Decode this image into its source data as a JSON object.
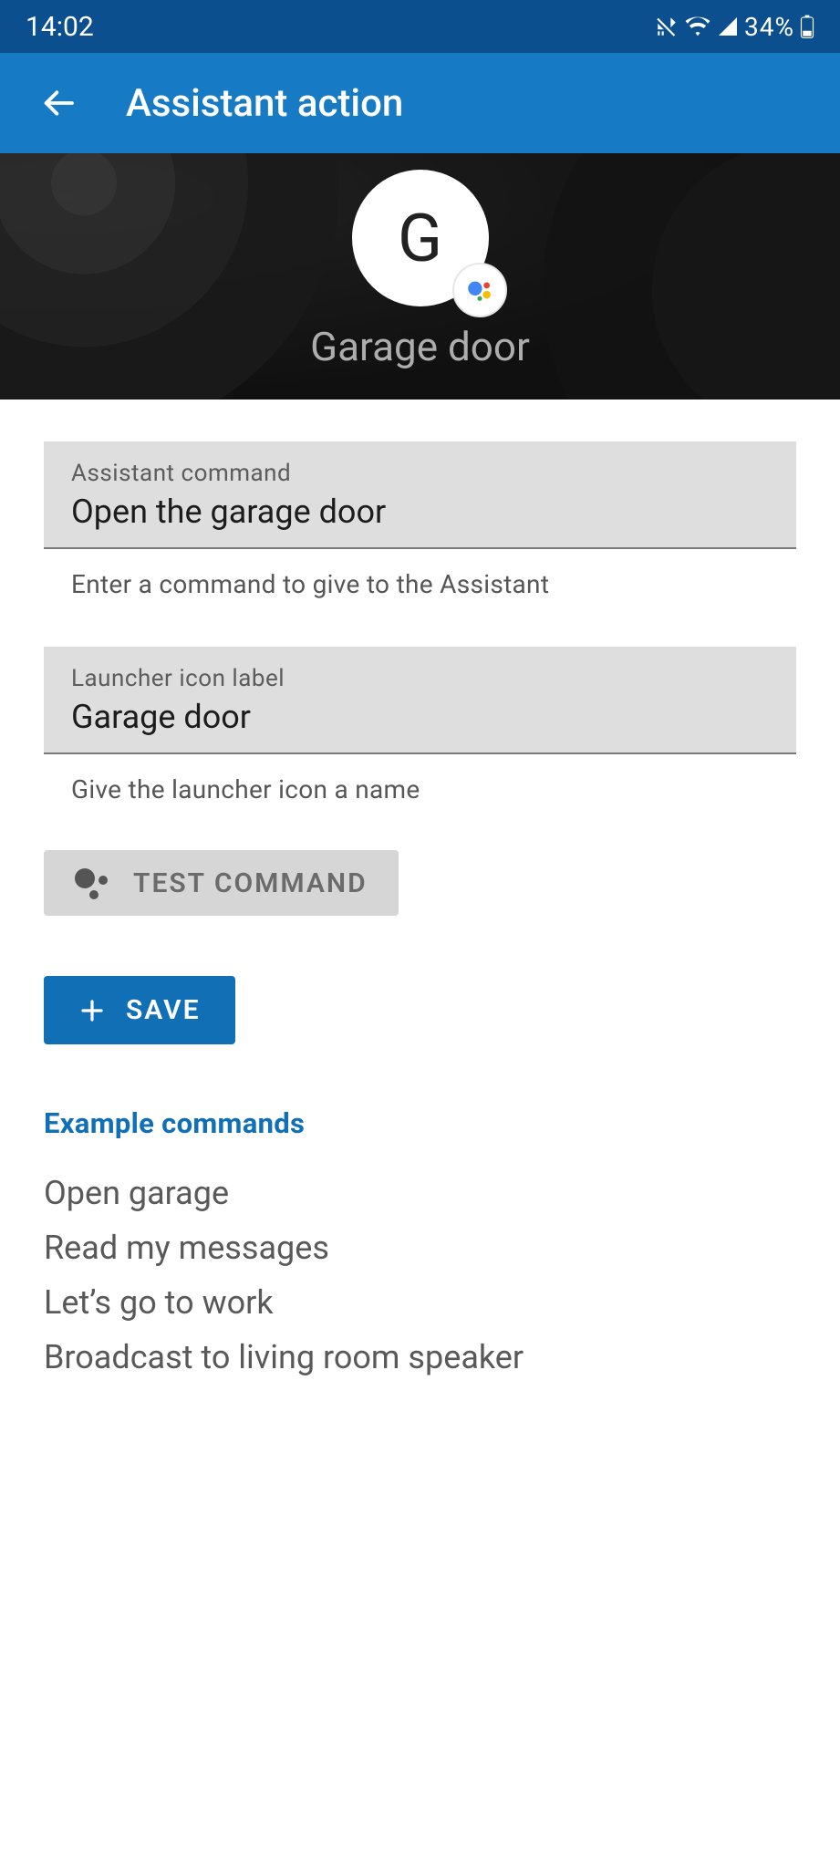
{
  "status": {
    "time": "14:02",
    "battery_text": "34%",
    "icons": [
      "vibrate",
      "wifi",
      "cellular",
      "battery"
    ]
  },
  "appbar": {
    "title": "Assistant action"
  },
  "hero": {
    "letter": "G",
    "title": "Garage door"
  },
  "fields": {
    "command": {
      "label": "Assistant command",
      "value": "Open the garage door",
      "helper": "Enter a command to give to the Assistant"
    },
    "label": {
      "label": "Launcher icon label",
      "value": "Garage door",
      "helper": "Give the launcher icon a name"
    }
  },
  "buttons": {
    "test": "TEST COMMAND",
    "save": "SAVE"
  },
  "examples": {
    "title": "Example commands",
    "items": [
      "Open garage",
      "Read my messages",
      "Let’s go to work",
      "Broadcast to living room speaker"
    ]
  },
  "colors": {
    "statusbar": "#0c4f8f",
    "appbar": "#167ac4",
    "primary": "#106fb5"
  }
}
